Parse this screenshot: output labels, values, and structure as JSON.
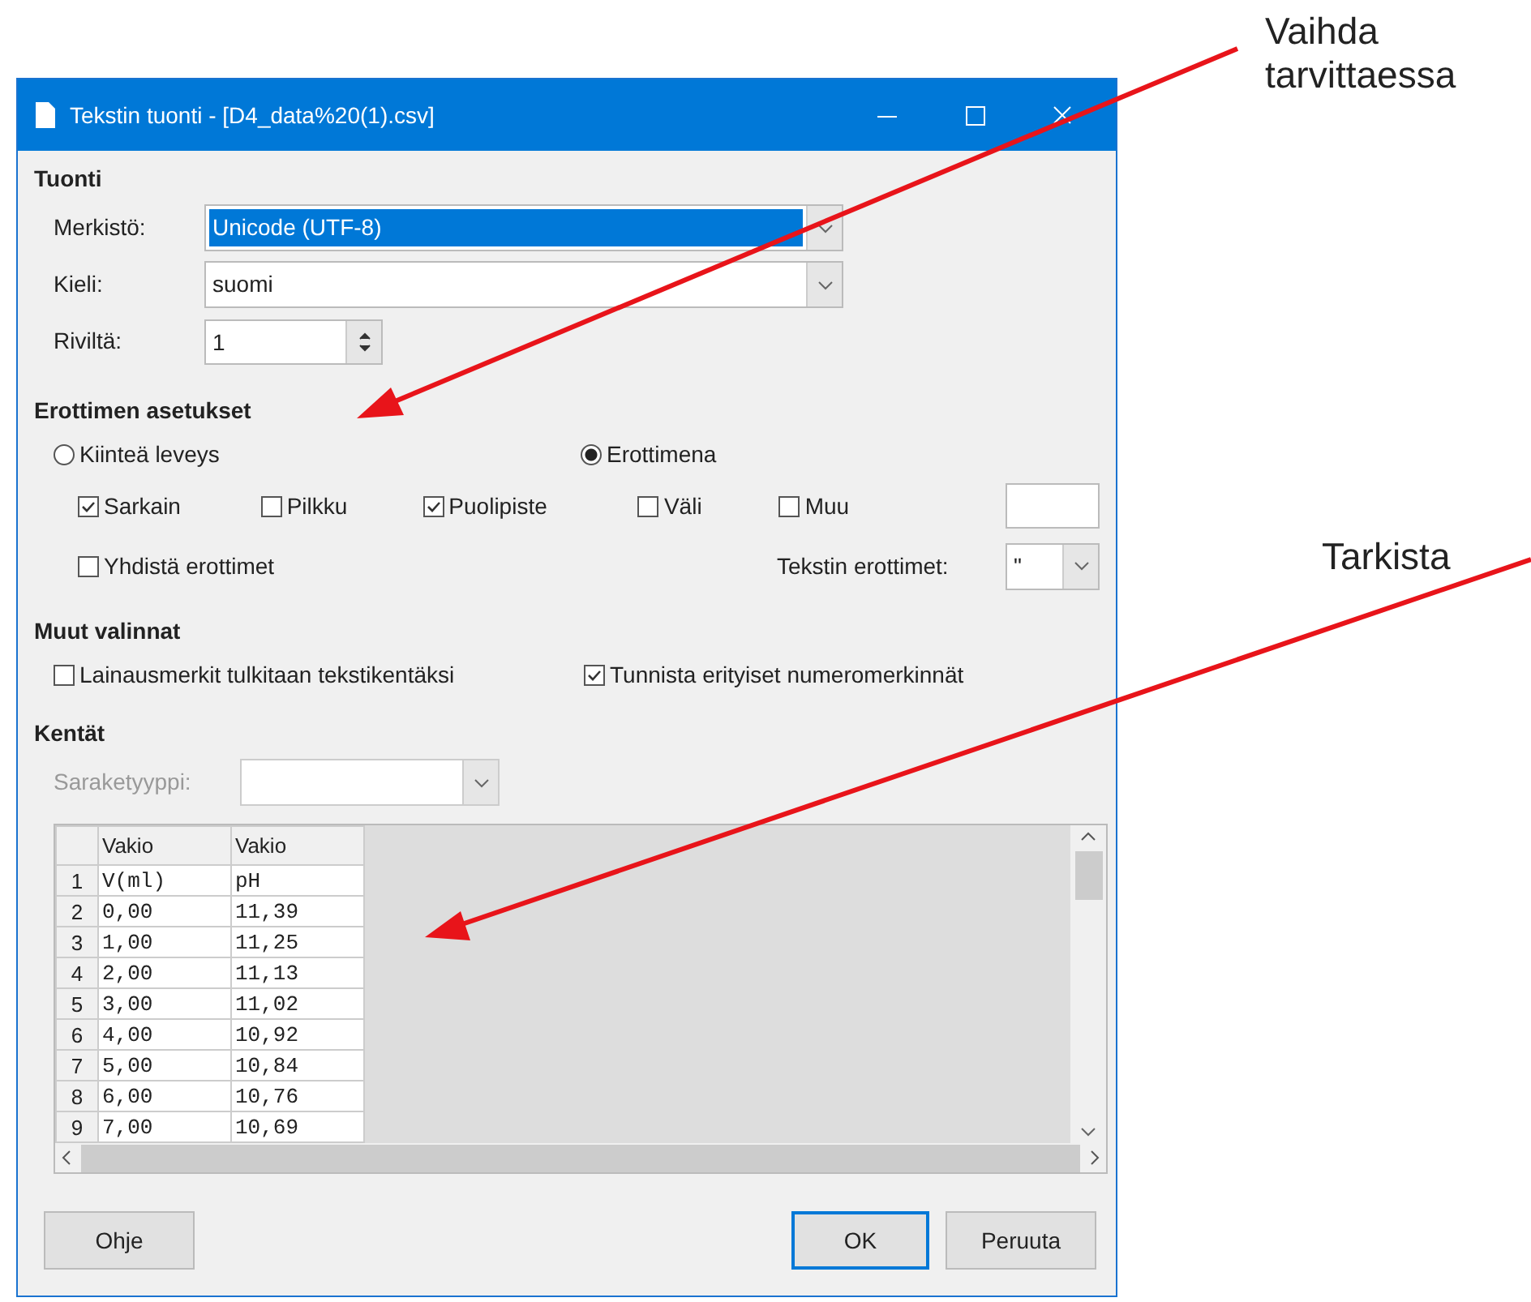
{
  "window": {
    "title": "Tekstin tuonti - [D4_data%20(1).csv]"
  },
  "import": {
    "heading": "Tuonti",
    "fields": [
      {
        "label": "Merkistö:",
        "kind": "combo",
        "value": "Unicode (UTF-8)",
        "selected": true
      },
      {
        "label": "Kieli:",
        "kind": "combo",
        "value": "suomi",
        "selected": false
      },
      {
        "label": "Riviltä:",
        "kind": "spin",
        "value": "1",
        "selected": false
      }
    ]
  },
  "separator_options": {
    "heading": "Erottimen asetukset",
    "modes": [
      {
        "label": "Kiinteä leveys",
        "selected": false
      },
      {
        "label": "Erottimena",
        "selected": true
      }
    ],
    "separators": [
      {
        "label": "Sarkain",
        "checked": true
      },
      {
        "label": "Pilkku",
        "checked": false
      },
      {
        "label": "Puolipiste",
        "checked": true
      },
      {
        "label": "Väli",
        "checked": false
      },
      {
        "label": "Muu",
        "checked": false
      }
    ],
    "merge": {
      "label": "Yhdistä erottimet",
      "checked": false
    },
    "text_delimiter": {
      "label": "Tekstin erottimet:",
      "value": "\""
    }
  },
  "other_options": {
    "heading": "Muut valinnat",
    "options": [
      {
        "label": "Lainausmerkit tulkitaan tekstikentäksi",
        "checked": false
      },
      {
        "label": "Tunnista erityiset numeromerkinnät",
        "checked": true
      }
    ]
  },
  "fields": {
    "heading": "Kentät",
    "column_type": {
      "label": "Saraketyyppi:",
      "disabled": true
    },
    "table": {
      "columns": [
        "Vakio",
        "Vakio"
      ],
      "rows": [
        {
          "number": "1",
          "cells": [
            "V(ml)",
            "pH"
          ]
        },
        {
          "number": "2",
          "cells": [
            "0,00",
            "11,39"
          ]
        },
        {
          "number": "3",
          "cells": [
            "1,00",
            "11,25"
          ]
        },
        {
          "number": "4",
          "cells": [
            "2,00",
            "11,13"
          ]
        },
        {
          "number": "5",
          "cells": [
            "3,00",
            "11,02"
          ]
        },
        {
          "number": "6",
          "cells": [
            "4,00",
            "10,92"
          ]
        },
        {
          "number": "7",
          "cells": [
            "5,00",
            "10,84"
          ]
        },
        {
          "number": "8",
          "cells": [
            "6,00",
            "10,76"
          ]
        },
        {
          "number": "9",
          "cells": [
            "7,00",
            "10,69"
          ]
        }
      ]
    }
  },
  "buttons": [
    {
      "label": "Ohje",
      "default": false
    },
    {
      "label": "OK",
      "default": true
    },
    {
      "label": "Peruuta",
      "default": false
    }
  ],
  "annotations": [
    {
      "text": "Vaihda tarvittaessa"
    },
    {
      "text": "Tarkista"
    }
  ]
}
